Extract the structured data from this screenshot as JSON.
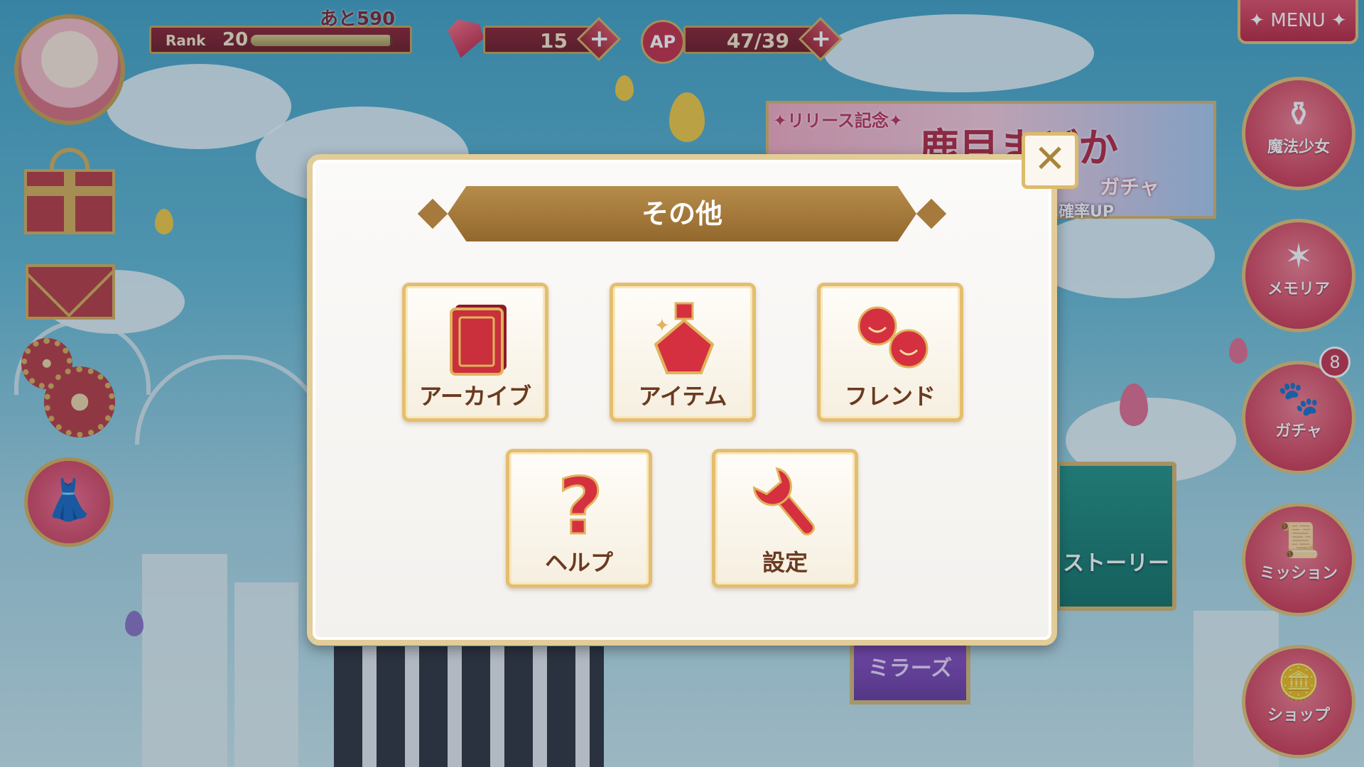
{
  "hud": {
    "rank_label": "Rank",
    "rank_value": "20",
    "rank_next": "あと590",
    "rank_exp_progress": 0.98,
    "gems": "15",
    "ap_icon_label": "AP",
    "ap_value": "47/39",
    "plus_symbol": "+",
    "menu_label": "✦ MENU ✦"
  },
  "banner": {
    "tag": "✦リリース記念✦",
    "title": "鹿目まどか",
    "subtitle": "ガチャ",
    "rate": "確率UP"
  },
  "side_nav": [
    {
      "label": "魔法少女",
      "icon": "flask-icon"
    },
    {
      "label": "メモリア",
      "icon": "star-icon"
    },
    {
      "label": "ガチャ",
      "icon": "kyubey-icon",
      "badge": "8"
    },
    {
      "label": "ミッション",
      "icon": "scroll-icon"
    },
    {
      "label": "ショップ",
      "icon": "coins-icon"
    }
  ],
  "background": {
    "story_label": "ストーリー",
    "mirrors_label": "ミラーズ"
  },
  "modal": {
    "title": "その他",
    "close_symbol": "✕",
    "items": [
      {
        "label": "アーカイブ",
        "icon": "archive-book-icon"
      },
      {
        "label": "アイテム",
        "icon": "potion-bottle-icon"
      },
      {
        "label": "フレンド",
        "icon": "friends-icon"
      },
      {
        "label": "ヘルプ",
        "icon": "help-question-icon"
      },
      {
        "label": "設定",
        "icon": "wrench-icon"
      }
    ]
  },
  "colors": {
    "accent_red": "#c52a43",
    "gold_border": "#e4be6f",
    "title_brown": "#93682d",
    "label_brown": "#6a3a20"
  }
}
